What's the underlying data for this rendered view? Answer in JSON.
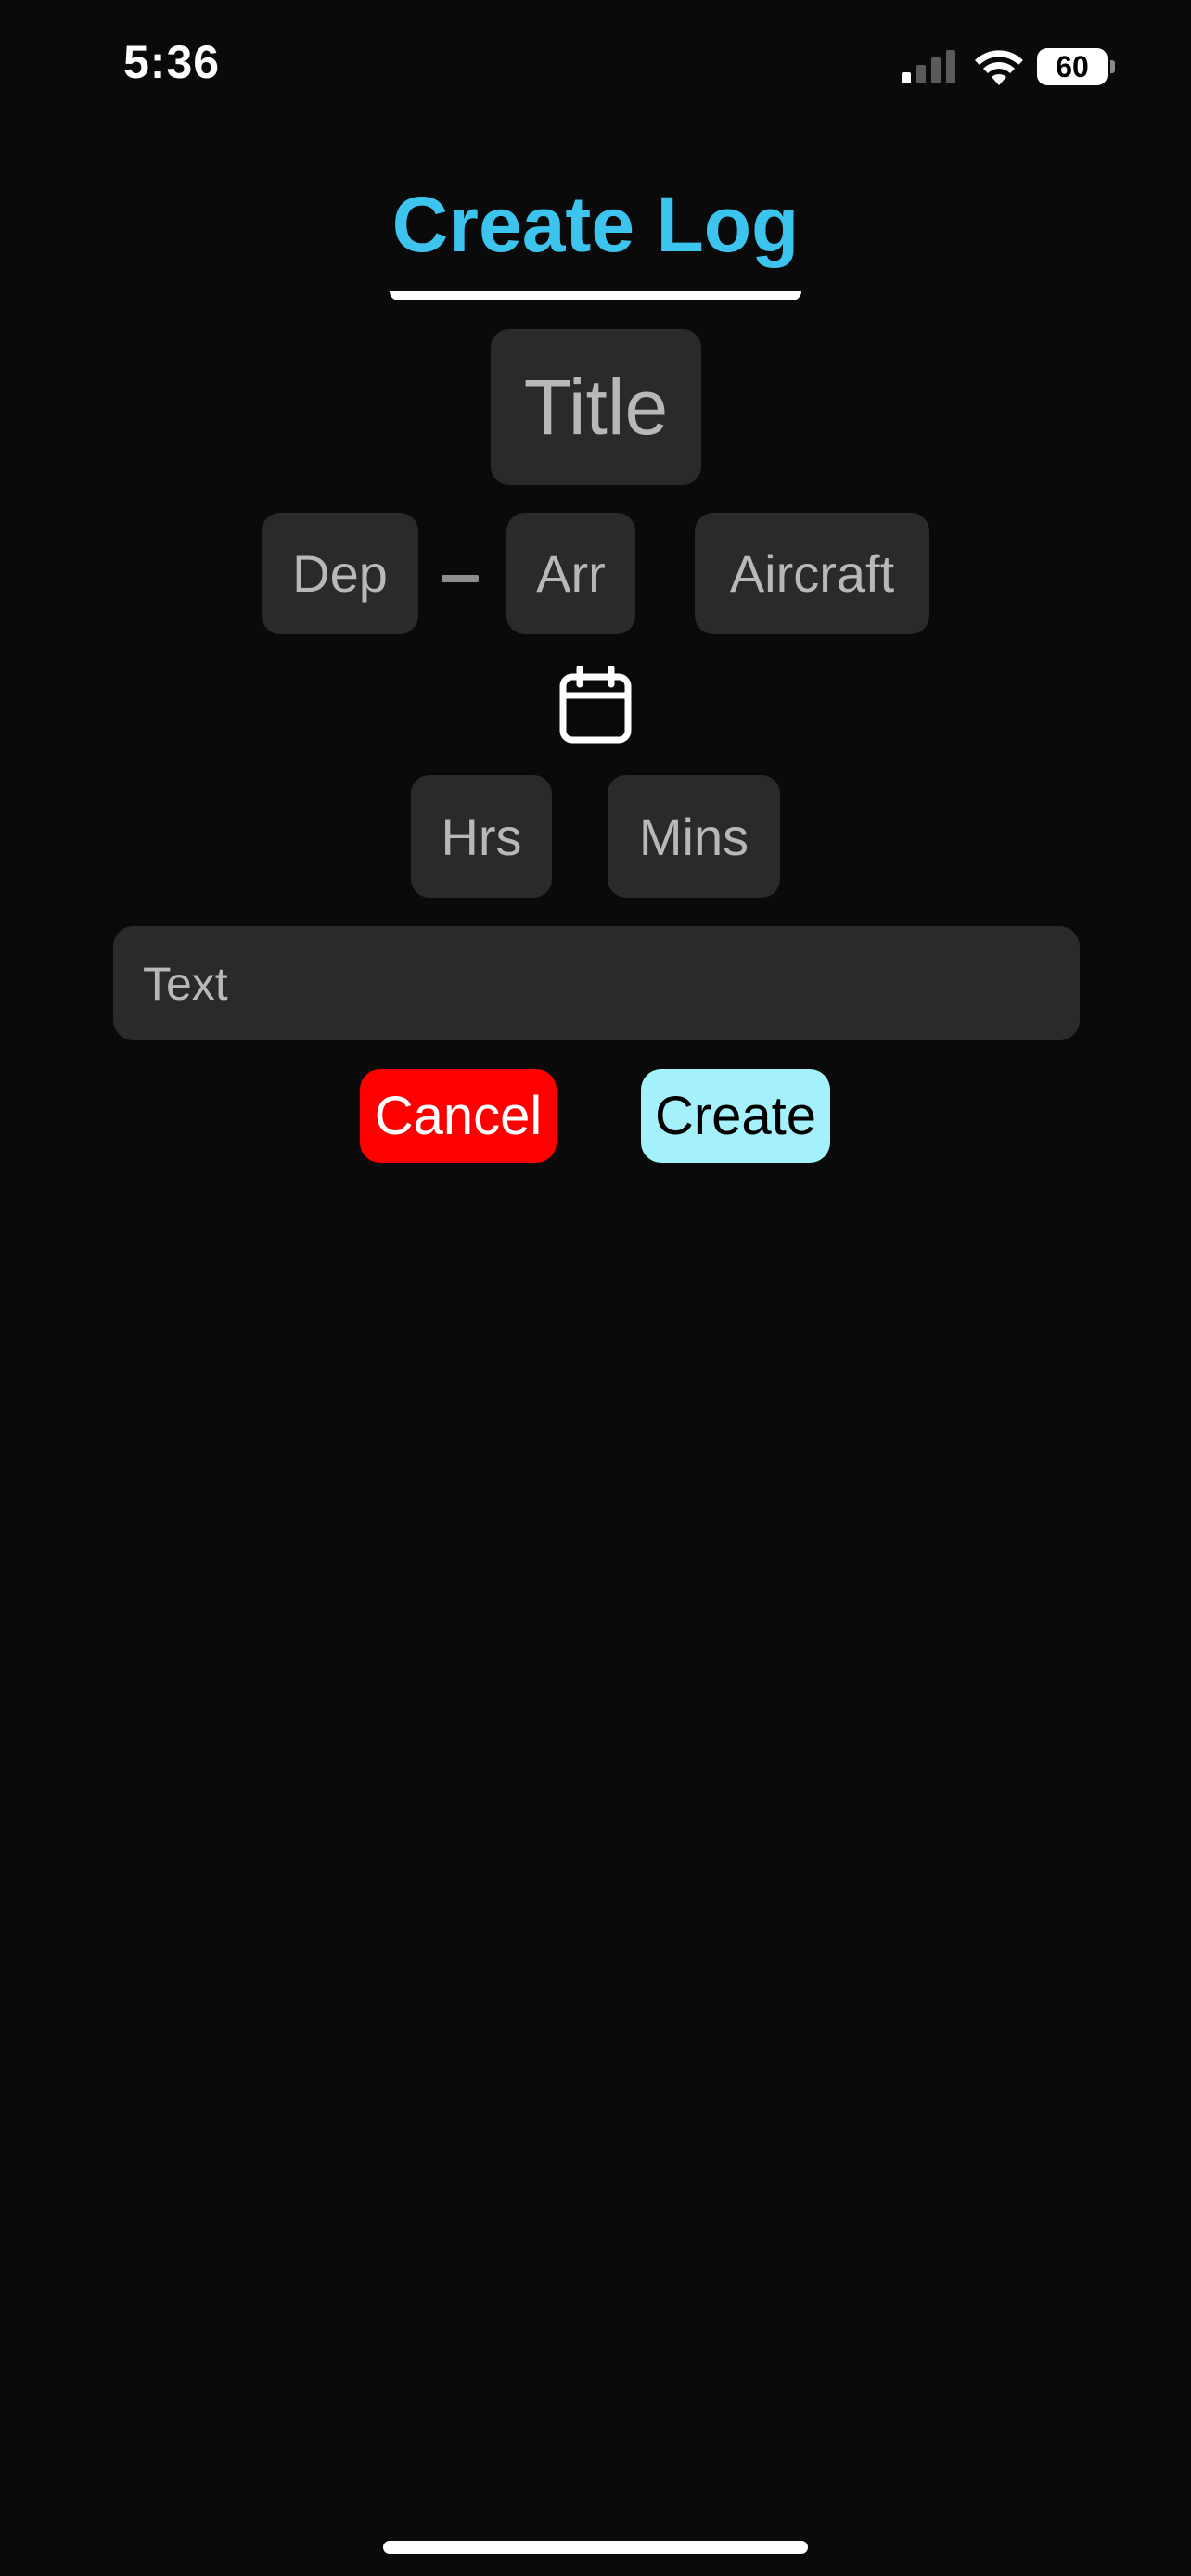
{
  "status_bar": {
    "time": "5:36",
    "battery_level": "60",
    "signal_icon": "cellular-signal-icon",
    "wifi_icon": "wifi-icon"
  },
  "page": {
    "title": "Create Log",
    "title_color": "#3cc4ee",
    "background_color": "#0a0a0a"
  },
  "form": {
    "title_placeholder": "Title",
    "departure_placeholder": "Dep",
    "arrival_placeholder": "Arr",
    "aircraft_placeholder": "Aircraft",
    "date_icon": "calendar-icon",
    "hours_placeholder": "Hrs",
    "minutes_placeholder": "Mins",
    "notes_placeholder": "Text"
  },
  "actions": {
    "cancel_label": "Cancel",
    "cancel_color": "#ff0000",
    "create_label": "Create",
    "create_color": "#a4f0fb"
  }
}
